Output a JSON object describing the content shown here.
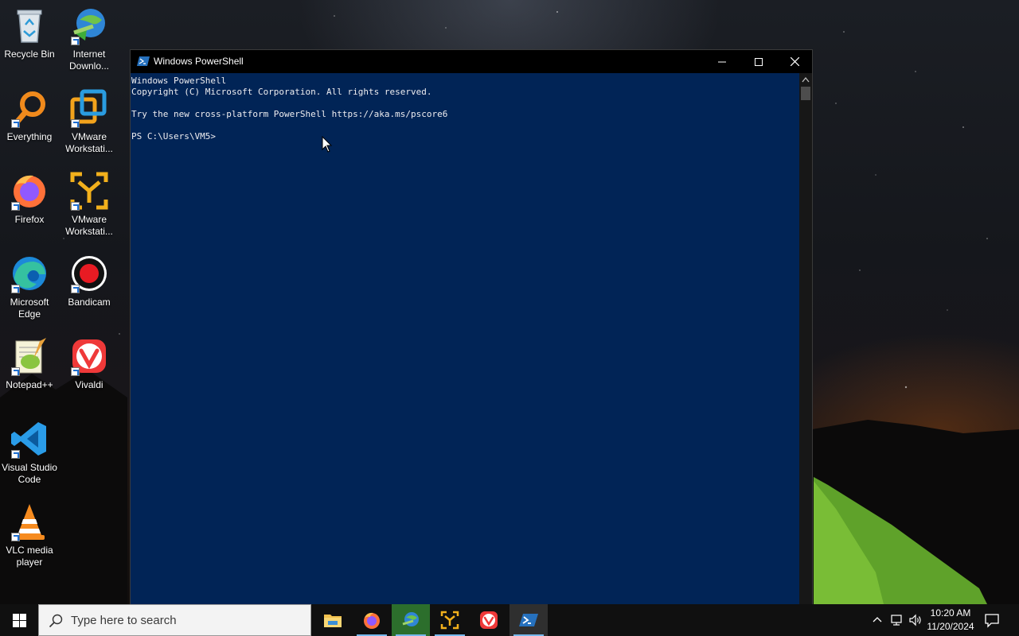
{
  "desktop": {
    "icons": [
      {
        "label": "Recycle Bin",
        "icon": "recycle-bin-icon"
      },
      {
        "label": "Internet Downlo...",
        "icon": "internet-download-manager-icon"
      },
      {
        "label": "Everything",
        "icon": "everything-search-icon"
      },
      {
        "label": "VMware Workstati...",
        "icon": "vmware-workstation-icon"
      },
      {
        "label": "Firefox",
        "icon": "firefox-icon"
      },
      {
        "label": "VMware Workstati...",
        "icon": "vmware-player-icon"
      },
      {
        "label": "Microsoft Edge",
        "icon": "edge-icon"
      },
      {
        "label": "Bandicam",
        "icon": "bandicam-icon"
      },
      {
        "label": "Notepad++",
        "icon": "notepadpp-icon"
      },
      {
        "label": "Vivaldi",
        "icon": "vivaldi-icon"
      },
      {
        "label": "Visual Studio Code",
        "icon": "vscode-icon"
      },
      {
        "label": "VLC media player",
        "icon": "vlc-icon"
      }
    ]
  },
  "powershell": {
    "title": "Windows PowerShell",
    "console_lines": [
      "Windows PowerShell",
      "Copyright (C) Microsoft Corporation. All rights reserved.",
      "",
      "Try the new cross-platform PowerShell https://aka.ms/pscore6",
      "",
      "PS C:\\Users\\VM5>"
    ],
    "background_color": "#012456",
    "text_color": "#eeedf0"
  },
  "taskbar": {
    "search_placeholder": "Type here to search",
    "apps": [
      {
        "name": "File Explorer",
        "icon": "file-explorer-icon"
      },
      {
        "name": "Firefox",
        "icon": "firefox-icon"
      },
      {
        "name": "Internet Download Manager",
        "icon": "internet-download-manager-icon"
      },
      {
        "name": "VMware Workstation",
        "icon": "vmware-player-icon"
      },
      {
        "name": "Vivaldi",
        "icon": "vivaldi-icon"
      },
      {
        "name": "Windows PowerShell",
        "icon": "powershell-icon"
      }
    ],
    "clock": {
      "time": "10:20 AM",
      "date": "11/20/2024"
    },
    "accent_color": "#76b9ed"
  }
}
